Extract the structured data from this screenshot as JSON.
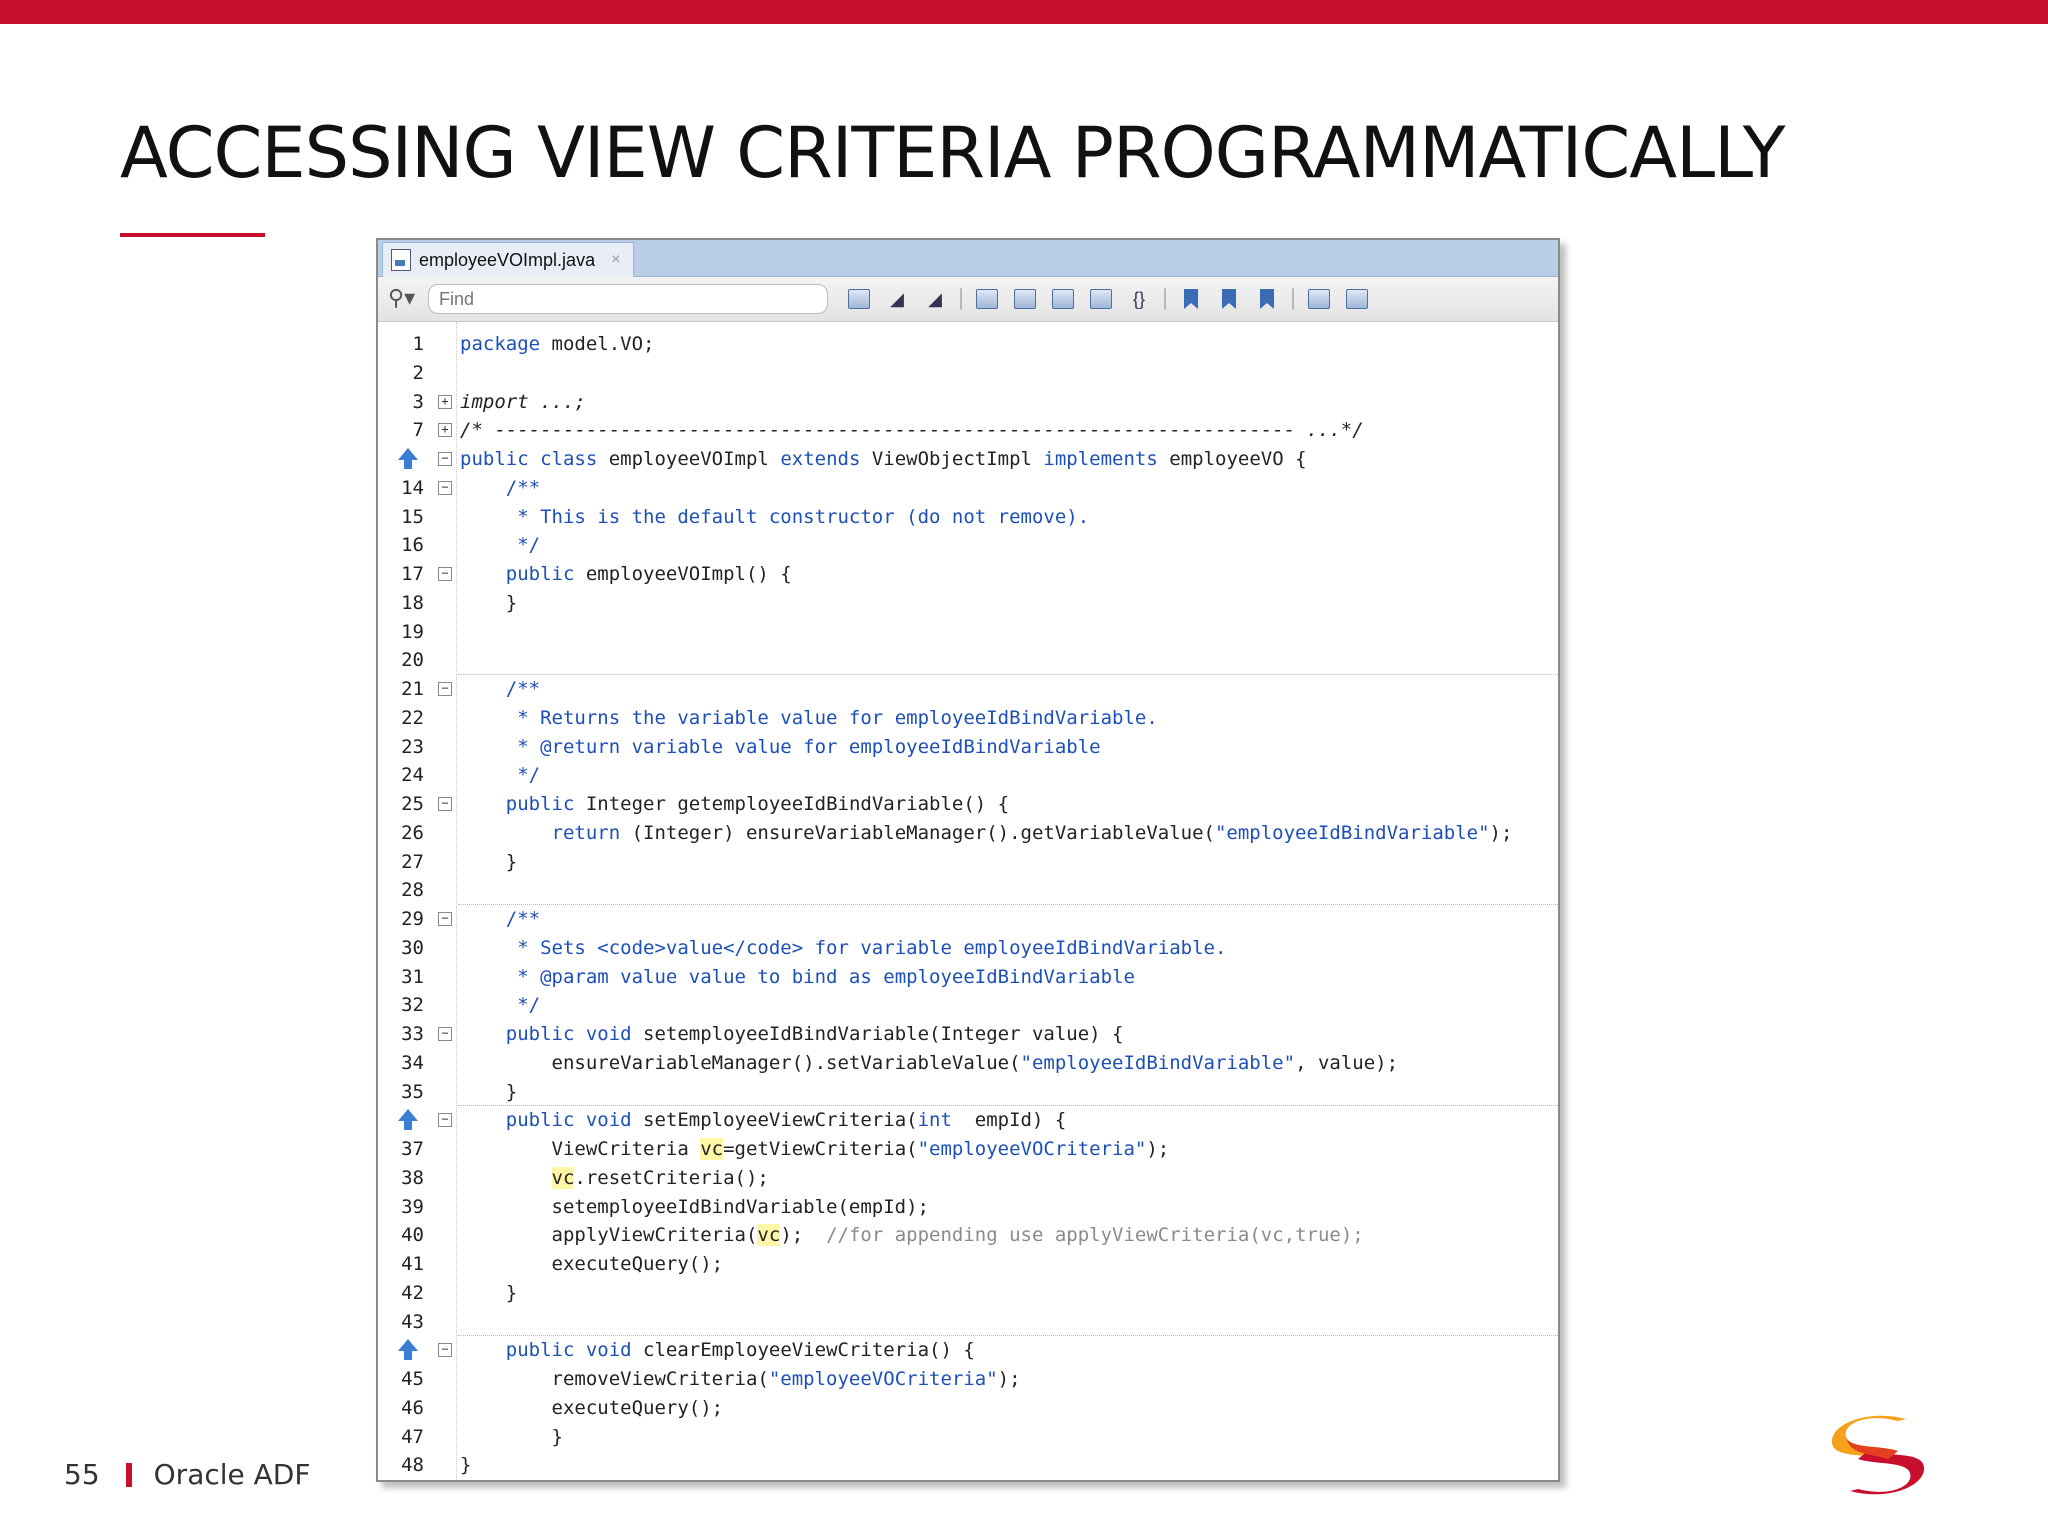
{
  "slide": {
    "title": "ACCESSING VIEW CRITERIA PROGRAMMATICALLY",
    "page_number": "55",
    "footer_label": "Oracle ADF",
    "brand_color": "#c8102e"
  },
  "editor": {
    "tab_label": "employeeVOImpl.java",
    "tab_close": "×",
    "find_placeholder": "Find",
    "toolbar_icons": [
      "quick-search-icon",
      "prev-occurrence-icon",
      "next-occurrence-icon",
      "find-selection-icon",
      "shift-left-icon",
      "shift-right-icon",
      "toggle-comment-icon",
      "braces-icon",
      "toggle-bookmark-icon",
      "prev-bookmark-icon",
      "next-bookmark-icon",
      "start-macro-icon",
      "stop-macro-icon"
    ]
  },
  "code": {
    "lines": [
      {
        "num": "1",
        "html": "<span class=\"kw\">package</span> model.VO;"
      },
      {
        "num": "2",
        "html": ""
      },
      {
        "num": "3",
        "fold": "+",
        "html": "<span class=\"it\">import ...;</span>"
      },
      {
        "num": "7",
        "fold": "+",
        "html": "<span class=\"it\">/* ---------------------------------------------------------------------- ...*/</span>"
      },
      {
        "num": "",
        "arrow": true,
        "fold": "-",
        "html": "<span class=\"kw\">public class</span> employeeVOImpl <span class=\"kw\">extends</span> ViewObjectImpl <span class=\"kw\">implements</span> employeeVO {"
      },
      {
        "num": "14",
        "fold": "-",
        "html": "    <span class=\"cm\">/**</span>"
      },
      {
        "num": "15",
        "html": "     <span class=\"cm\">* This is the default constructor (do not remove).</span>"
      },
      {
        "num": "16",
        "html": "     <span class=\"cm\">*/</span>"
      },
      {
        "num": "17",
        "fold": "-",
        "html": "    <span class=\"kw\">public</span> employeeVOImpl() {"
      },
      {
        "num": "18",
        "html": "    }"
      },
      {
        "num": "19",
        "html": ""
      },
      {
        "num": "20",
        "html": ""
      },
      {
        "num": "21",
        "fold": "-",
        "sep": true,
        "html": "    <span class=\"cm\">/**</span>"
      },
      {
        "num": "22",
        "html": "     <span class=\"cm\">* Returns the variable value for employeeIdBindVariable.</span>"
      },
      {
        "num": "23",
        "html": "     <span class=\"cm\">* @return variable value for employeeIdBindVariable</span>"
      },
      {
        "num": "24",
        "html": "     <span class=\"cm\">*/</span>"
      },
      {
        "num": "25",
        "fold": "-",
        "html": "    <span class=\"kw\">public</span> Integer getemployeeIdBindVariable() {"
      },
      {
        "num": "26",
        "html": "        <span class=\"kw\">return</span> (Integer) ensureVariableManager().getVariableValue(<span class=\"str\">\"employeeIdBindVariable\"</span>);"
      },
      {
        "num": "27",
        "html": "    }"
      },
      {
        "num": "28",
        "html": ""
      },
      {
        "num": "29",
        "fold": "-",
        "sep": true,
        "html": "    <span class=\"cm\">/**</span>"
      },
      {
        "num": "30",
        "html": "     <span class=\"cm\">* Sets &lt;code&gt;value&lt;/code&gt; for variable employeeIdBindVariable.</span>"
      },
      {
        "num": "31",
        "html": "     <span class=\"cm\">* @param value value to bind as employeeIdBindVariable</span>"
      },
      {
        "num": "32",
        "html": "     <span class=\"cm\">*/</span>"
      },
      {
        "num": "33",
        "fold": "-",
        "html": "    <span class=\"kw\">public void</span> setemployeeIdBindVariable(Integer value) {"
      },
      {
        "num": "34",
        "html": "        ensureVariableManager().setVariableValue(<span class=\"str\">\"employeeIdBindVariable\"</span>, value);"
      },
      {
        "num": "35",
        "html": "    }"
      },
      {
        "num": "",
        "arrow": true,
        "fold": "-",
        "sep": true,
        "html": "    <span class=\"kw\">public void</span> setEmployeeViewCriteria(<span class=\"kw\">int</span>  empId) {"
      },
      {
        "num": "37",
        "html": "        ViewCriteria <span class=\"hl\">vc</span>=getViewCriteria(<span class=\"str\">\"employeeVOCriteria\"</span>);"
      },
      {
        "num": "38",
        "html": "        <span class=\"hl\">vc</span>.resetCriteria();"
      },
      {
        "num": "39",
        "html": "        setemployeeIdBindVariable(empId);"
      },
      {
        "num": "40",
        "html": "        applyViewCriteria(<span class=\"hl\">vc</span>);  <span class=\"gray\">//for appending use applyViewCriteria(vc,true);</span>"
      },
      {
        "num": "41",
        "html": "        executeQuery();"
      },
      {
        "num": "42",
        "html": "    }"
      },
      {
        "num": "43",
        "html": ""
      },
      {
        "num": "",
        "arrow": true,
        "fold": "-",
        "sep": true,
        "html": "    <span class=\"kw\">public void</span> clearEmployeeViewCriteria() {"
      },
      {
        "num": "45",
        "html": "        removeViewCriteria(<span class=\"str\">\"employeeVOCriteria\"</span>);"
      },
      {
        "num": "46",
        "html": "        executeQuery();"
      },
      {
        "num": "47",
        "html": "        }"
      },
      {
        "num": "48",
        "html": "}"
      }
    ]
  }
}
